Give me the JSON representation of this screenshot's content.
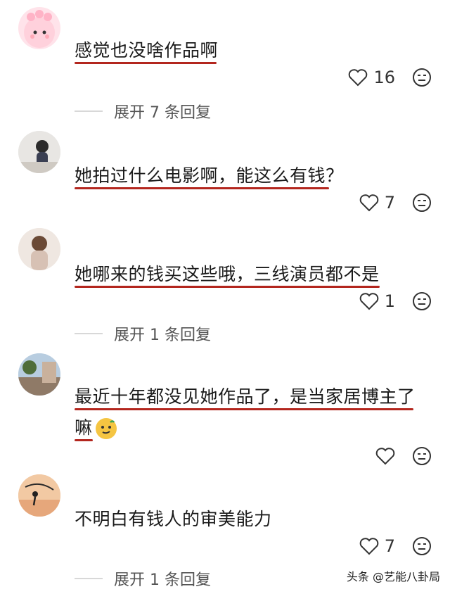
{
  "comments": [
    {
      "text": "感觉也没啥作品啊",
      "likes": "16",
      "replies": "展开 7 条回复"
    },
    {
      "text": "她拍过什么电影啊，能这么有钱？",
      "likes": "7",
      "replies": ""
    },
    {
      "text": "她哪来的钱买这些哦，三线演员都不是",
      "likes": "1",
      "replies": "展开 1 条回复"
    },
    {
      "text_line1": "最近十年都没见她作品了，是当家居博主了",
      "text_line2": "嘛",
      "likes": "",
      "replies": ""
    },
    {
      "text": "不明白有钱人的审美能力",
      "likes": "7",
      "replies": "展开 1 条回复"
    }
  ],
  "watermark": "头条 @艺能八卦局",
  "colors": {
    "underline": "#b3261e",
    "text": "#1a1a1a",
    "meta": "#555555"
  },
  "icons": {
    "like": "heart-icon",
    "react": "meh-face-icon"
  }
}
